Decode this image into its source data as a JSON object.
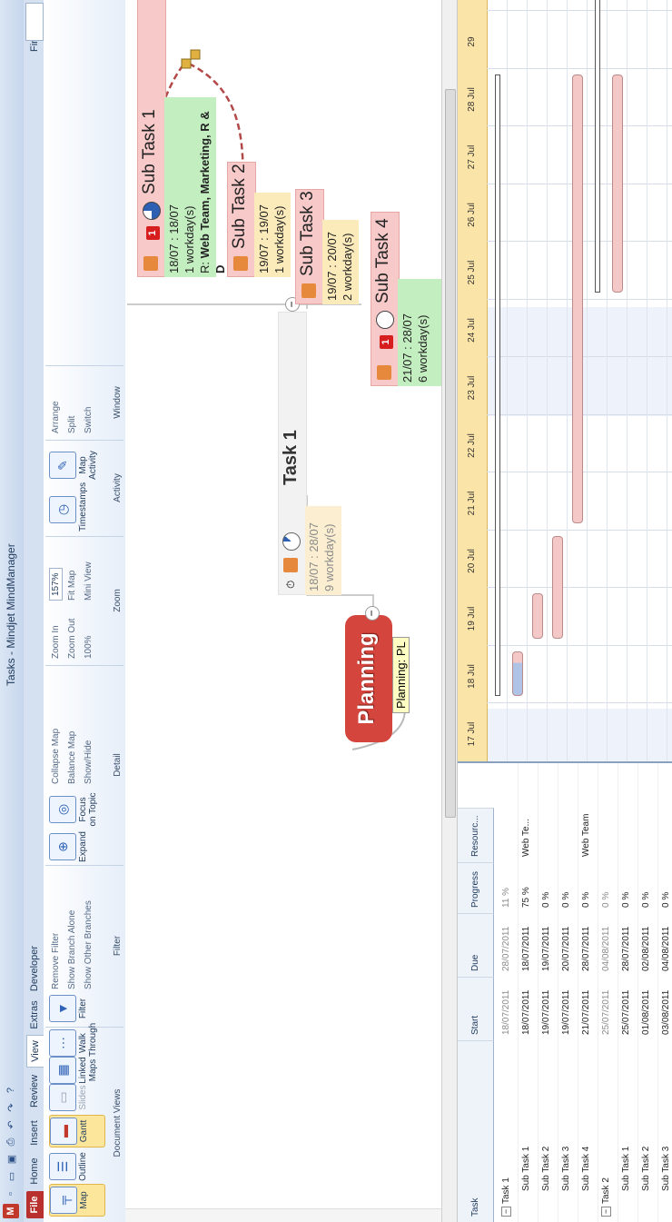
{
  "window": {
    "title": "Tasks - Mindjet MindManager"
  },
  "tabs": [
    "File",
    "Home",
    "Insert",
    "Review",
    "View",
    "Extras",
    "Developer"
  ],
  "ribbon": {
    "document_views": {
      "label": "Document Views",
      "map": "Map",
      "outline": "Outline",
      "gantt": "Gantt",
      "slides": "Slides",
      "linked_maps": "Linked Maps",
      "walk_through": "Walk Through"
    },
    "filter": {
      "label": "Filter",
      "filter_btn": "Filter",
      "remove_filter": "Remove Filter",
      "show_branch_alone": "Show Branch Alone",
      "show_other_branches": "Show Other Branches"
    },
    "detail": {
      "label": "Detail",
      "expand": "Expand",
      "focus_on_topic": "Focus on Topic",
      "collapse_map": "Collapse Map",
      "balance_map": "Balance Map",
      "show_hide": "Show/Hide"
    },
    "zoom": {
      "label": "Zoom",
      "zoom_in": "Zoom In",
      "zoom_out": "Zoom Out",
      "hundred": "100%",
      "zoom_value": "157%",
      "fit_map": "Fit Map",
      "mini_view": "Mini View"
    },
    "activity": {
      "label": "Activity",
      "timestamps": "Timestamps",
      "map_activity": "Map Activity"
    },
    "window": {
      "label": "Window",
      "arrange": "Arrange",
      "split": "Split",
      "switch": "Switch"
    },
    "find_label": "Find:"
  },
  "map": {
    "central": {
      "title": "Planning",
      "callout": "Planning: PL"
    },
    "task1": {
      "title": "Task 1",
      "dates": "18/07 : 28/07",
      "duration": "9 workday(s)"
    },
    "subtasks": [
      {
        "title": "Sub Task 1",
        "priority": "1",
        "dates": "18/07 : 18/07",
        "duration": "1 workday(s)",
        "resources_prefix": "R: ",
        "resources": "Web Team, Marketing, R & D"
      },
      {
        "title": "Sub Task 2",
        "dates": "19/07 : 19/07",
        "duration": "1 workday(s)"
      },
      {
        "title": "Sub Task 3",
        "dates": "19/07 : 20/07",
        "duration": "2 workday(s)"
      },
      {
        "title": "Sub Task 4",
        "priority": "1",
        "dates": "21/07 : 28/07",
        "duration": "6 workday(s)"
      }
    ]
  },
  "task_table": {
    "headers": [
      "Task",
      "Start",
      "Due",
      "Progress",
      "Resourc..."
    ],
    "rows": [
      {
        "task": "Task 1",
        "start": "18/07/2011",
        "due": "28/07/2011",
        "progress": "11 %",
        "resources": ""
      },
      {
        "task": "Sub Task 1",
        "start": "18/07/2011",
        "due": "18/07/2011",
        "progress": "75 %",
        "resources": "Web Te..."
      },
      {
        "task": "Sub Task 2",
        "start": "19/07/2011",
        "due": "19/07/2011",
        "progress": "0 %",
        "resources": ""
      },
      {
        "task": "Sub Task 3",
        "start": "19/07/2011",
        "due": "20/07/2011",
        "progress": "0 %",
        "resources": ""
      },
      {
        "task": "Sub Task 4",
        "start": "21/07/2011",
        "due": "28/07/2011",
        "progress": "0 %",
        "resources": "Web Team"
      },
      {
        "task": "Task 2",
        "start": "25/07/2011",
        "due": "04/08/2011",
        "progress": "0 %",
        "resources": ""
      },
      {
        "task": "Sub Task 1",
        "start": "25/07/2011",
        "due": "28/07/2011",
        "progress": "0 %",
        "resources": ""
      },
      {
        "task": "Sub Task 2",
        "start": "01/08/2011",
        "due": "02/08/2011",
        "progress": "0 %",
        "resources": ""
      },
      {
        "task": "Sub Task 3",
        "start": "03/08/2011",
        "due": "04/08/2011",
        "progress": "0 %",
        "resources": ""
      }
    ]
  },
  "gantt": {
    "days": [
      "17 Jul",
      "18 Jul",
      "19 Jul",
      "20 Jul",
      "21 Jul",
      "22 Jul",
      "23 Jul",
      "24 Jul",
      "25 Jul",
      "26 Jul",
      "27 Jul",
      "28 Jul",
      "29"
    ]
  },
  "colors": {
    "accent": "#b8312f",
    "subtask": "#f7c9c9",
    "resource_box": "#c3eec0",
    "date_box": "#fcebba",
    "gantt_header": "#fbe4a8"
  }
}
